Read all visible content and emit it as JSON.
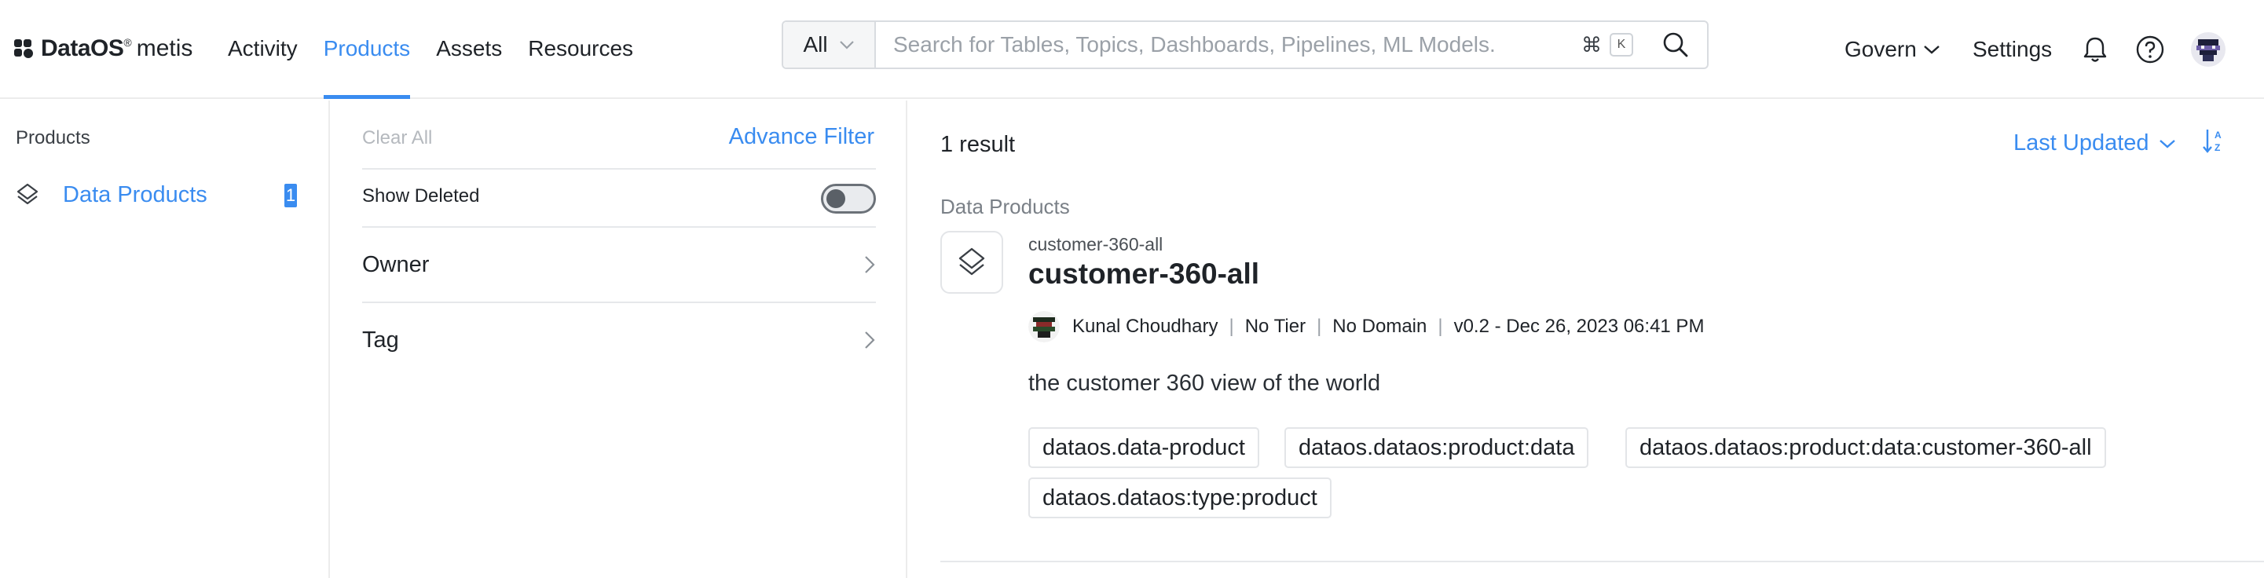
{
  "brand": {
    "name": "DataOS",
    "registered": "®",
    "product": "metis"
  },
  "nav": {
    "items": [
      {
        "label": "Activity"
      },
      {
        "label": "Products",
        "active": true
      },
      {
        "label": "Assets"
      },
      {
        "label": "Resources"
      }
    ]
  },
  "search": {
    "scope": "All",
    "placeholder": "Search for Tables, Topics, Dashboards, Pipelines, ML Models.",
    "shortcut_mod": "⌘",
    "shortcut_key": "K"
  },
  "header_right": {
    "govern_label": "Govern",
    "settings_label": "Settings"
  },
  "sidebar": {
    "heading": "Products",
    "items": [
      {
        "label": "Data Products",
        "count": "1"
      }
    ]
  },
  "filters": {
    "clear_all": "Clear All",
    "advance_filter": "Advance Filter",
    "show_deleted": "Show Deleted",
    "show_deleted_on": false,
    "rows": [
      {
        "label": "Owner"
      },
      {
        "label": "Tag"
      }
    ]
  },
  "results": {
    "count_text": "1 result",
    "sort_label": "Last Updated",
    "section_label": "Data Products",
    "items": [
      {
        "fqn": "customer-360-all",
        "title": "customer-360-all",
        "owner": "Kunal Choudhary",
        "tier": "No Tier",
        "domain": "No Domain",
        "version": "v0.2 - Dec 26, 2023 06:41 PM",
        "description": "the customer 360 view of the world",
        "tags": [
          "dataos.data-product",
          "dataos.dataos:product:data",
          "dataos.dataos:product:data:customer-360-all",
          "dataos.dataos:type:product"
        ]
      }
    ]
  },
  "colors": {
    "accent": "#3a8cf0",
    "text": "#1f2328",
    "muted": "#7a8087",
    "border": "#e3e5e8"
  }
}
